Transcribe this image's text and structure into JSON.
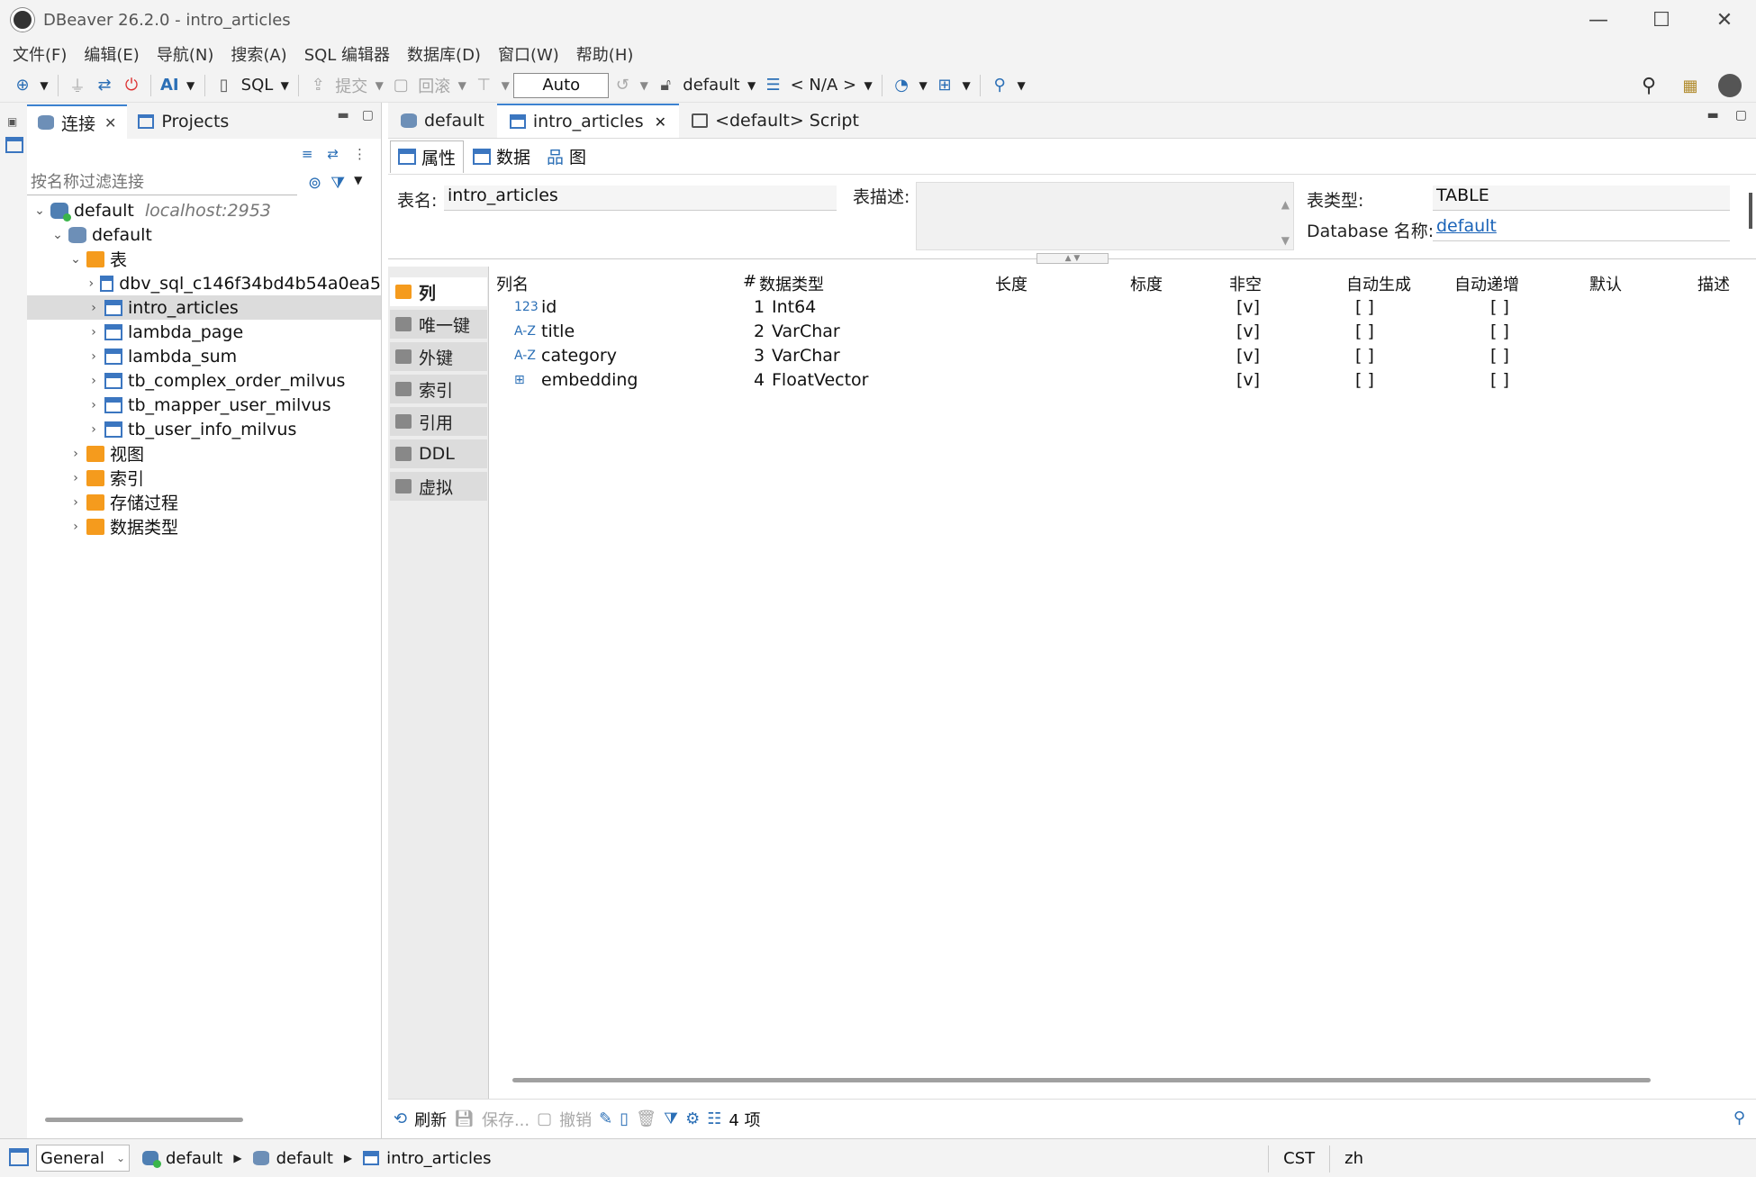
{
  "window": {
    "title": "DBeaver 26.2.0 - intro_articles",
    "minimize": "—",
    "maximize": "☐",
    "close": "✕"
  },
  "menu": [
    "文件(F)",
    "编辑(E)",
    "导航(N)",
    "搜索(A)",
    "SQL 编辑器",
    "数据库(D)",
    "窗口(W)",
    "帮助(H)"
  ],
  "toolbar": {
    "ai_label": "AI",
    "sql_label": "SQL",
    "commit_label": "提交",
    "rollback_label": "回滚",
    "transaction_mode": "Auto",
    "database_selector": "default",
    "schema_selector": "< N/A >"
  },
  "left_panel": {
    "tab_connections": "连接",
    "tab_projects": "Projects",
    "filter_placeholder": "按名称过滤连接",
    "tree": [
      {
        "label": "default",
        "host": "localhost:2953",
        "level": 0,
        "icon": "conn",
        "expanded": true
      },
      {
        "label": "default",
        "level": 1,
        "icon": "db",
        "expanded": true
      },
      {
        "label": "表",
        "level": 2,
        "icon": "folder",
        "expanded": true
      },
      {
        "label": "dbv_sql_c146f34bd4b54a0ea5",
        "level": 3,
        "icon": "table"
      },
      {
        "label": "intro_articles",
        "level": 3,
        "icon": "table",
        "selected": true
      },
      {
        "label": "lambda_page",
        "level": 3,
        "icon": "table"
      },
      {
        "label": "lambda_sum",
        "level": 3,
        "icon": "table"
      },
      {
        "label": "tb_complex_order_milvus",
        "level": 3,
        "icon": "table"
      },
      {
        "label": "tb_mapper_user_milvus",
        "level": 3,
        "icon": "table"
      },
      {
        "label": "tb_user_info_milvus",
        "level": 3,
        "icon": "table"
      },
      {
        "label": "视图",
        "level": 2,
        "icon": "folder"
      },
      {
        "label": "索引",
        "level": 2,
        "icon": "folder"
      },
      {
        "label": "存储过程",
        "level": 2,
        "icon": "folder"
      },
      {
        "label": "数据类型",
        "level": 2,
        "icon": "folder"
      }
    ]
  },
  "editor": {
    "tabs": [
      {
        "label": "default",
        "active": false
      },
      {
        "label": "intro_articles",
        "active": true
      },
      {
        "label": "<default> Script",
        "active": false
      }
    ],
    "sub_tabs": [
      "属性",
      "数据",
      "图"
    ],
    "props": {
      "table_name_label": "表名:",
      "table_name_value": "intro_articles",
      "desc_label": "表描述:",
      "type_label": "表类型:",
      "type_value": "TABLE",
      "dbname_label": "Database 名称:",
      "dbname_value": "default"
    },
    "side_nav": [
      "列",
      "唯一键",
      "外键",
      "索引",
      "引用",
      "DDL",
      "虚拟"
    ],
    "columns_header": [
      "列名",
      "#",
      "数据类型",
      "长度",
      "标度",
      "非空",
      "自动生成",
      "自动递增",
      "默认",
      "描述"
    ],
    "rows": [
      {
        "icon": "123",
        "name": "id",
        "num": "1",
        "type": "Int64",
        "notnull": "[v]",
        "autogen": "[ ]",
        "autoinc": "[ ]"
      },
      {
        "icon": "A-Z",
        "name": "title",
        "num": "2",
        "type": "VarChar",
        "notnull": "[v]",
        "autogen": "[ ]",
        "autoinc": "[ ]"
      },
      {
        "icon": "A-Z",
        "name": "category",
        "num": "3",
        "type": "VarChar",
        "notnull": "[v]",
        "autogen": "[ ]",
        "autoinc": "[ ]"
      },
      {
        "icon": "⊞",
        "name": "embedding",
        "num": "4",
        "type": "FloatVector",
        "notnull": "[v]",
        "autogen": "[ ]",
        "autoinc": "[ ]"
      }
    ],
    "bottom": {
      "refresh": "刷新",
      "save": "保存...",
      "cancel": "撤销",
      "count": "4 项"
    }
  },
  "statusbar": {
    "workspace": "General",
    "crumbs": [
      "default",
      "default",
      "intro_articles"
    ],
    "timezone": "CST",
    "locale": "zh"
  }
}
